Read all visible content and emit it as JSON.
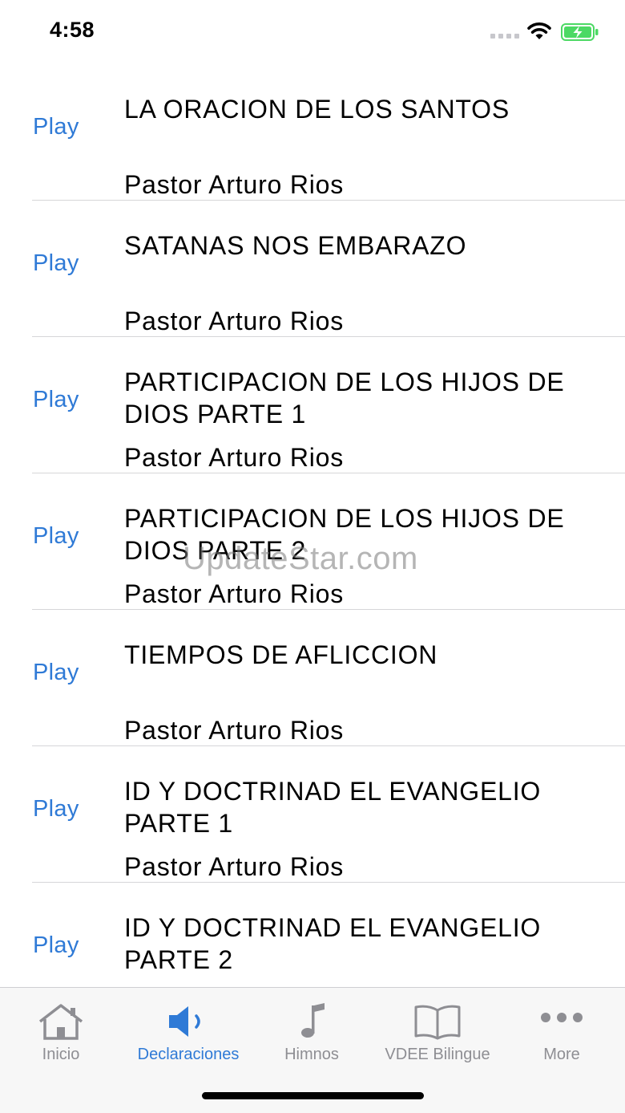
{
  "status_bar": {
    "time": "4:58",
    "signal_icon": "cellular-dots-icon",
    "wifi_icon": "wifi-icon",
    "battery_icon": "battery-charging-icon",
    "battery_color": "#4cd964"
  },
  "colors": {
    "accent": "#2f7ad6",
    "inactive_tab": "#8e8e93"
  },
  "list": {
    "items": [
      {
        "play_label": "Play",
        "title": "LA ORACION DE LOS SANTOS",
        "author": "Pastor Arturo Rios"
      },
      {
        "play_label": "Play",
        "title": "SATANAS NOS EMBARAZO",
        "author": "Pastor Arturo Rios"
      },
      {
        "play_label": "Play",
        "title": "PARTICIPACION DE LOS HIJOS DE DIOS PARTE 1",
        "author": "Pastor Arturo Rios"
      },
      {
        "play_label": "Play",
        "title": "PARTICIPACION DE LOS HIJOS DE DIOS PARTE 2",
        "author": "Pastor Arturo Rios"
      },
      {
        "play_label": "Play",
        "title": "TIEMPOS DE AFLICCION",
        "author": "Pastor Arturo Rios"
      },
      {
        "play_label": "Play",
        "title": "ID Y DOCTRINAD EL EVANGELIO PARTE 1",
        "author": "Pastor Arturo Rios"
      },
      {
        "play_label": "Play",
        "title": "ID Y DOCTRINAD EL EVANGELIO PARTE 2",
        "author": ""
      }
    ]
  },
  "watermark": "UpdateStar.com",
  "tab_bar": {
    "tabs": [
      {
        "label": "Inicio",
        "icon": "house-icon",
        "active": false
      },
      {
        "label": "Declaraciones",
        "icon": "speaker-icon",
        "active": true
      },
      {
        "label": "Himnos",
        "icon": "music-note-icon",
        "active": false
      },
      {
        "label": "VDEE Bilingue",
        "icon": "book-icon",
        "active": false
      },
      {
        "label": "More",
        "icon": "more-dots-icon",
        "active": false
      }
    ]
  }
}
